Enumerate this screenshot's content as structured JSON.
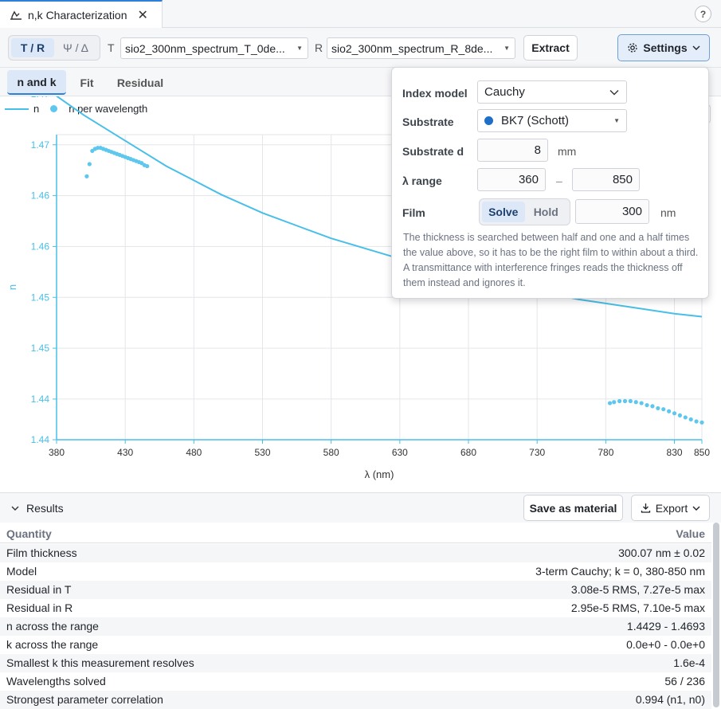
{
  "tab": {
    "title": "n,k Characterization",
    "close": "✕"
  },
  "help": "?",
  "toolbar": {
    "mode_tr": "T / R",
    "mode_psi": "Ψ / Δ",
    "t_label": "T",
    "t_file": "sio2_300nm_spectrum_T_0de...",
    "r_label": "R",
    "r_file": "sio2_300nm_spectrum_R_8de...",
    "extract": "Extract",
    "settings": "Settings"
  },
  "view_tabs": [
    "n and k",
    "Fit",
    "Residual"
  ],
  "settings": {
    "index_model_label": "Index model",
    "index_model": "Cauchy",
    "substrate_label": "Substrate",
    "substrate": "BK7 (Schott)",
    "substrate_color": "#1f6fc9",
    "substrate_d_label": "Substrate d",
    "substrate_d": "8",
    "substrate_d_unit": "mm",
    "range_label": "λ range",
    "range_min": "360",
    "range_sep": "–",
    "range_max": "850",
    "film_label": "Film",
    "film_solve": "Solve",
    "film_hold": "Hold",
    "film_value": "300",
    "film_unit": "nm",
    "note": "The thickness is searched between half and one and a half times the value above, so it has to be the right film to within about a third. A transmittance with interference fringes reads the thickness off them instead and ignores it."
  },
  "chart_data": {
    "type": "line",
    "xlabel": "λ (nm)",
    "ylabel": "n",
    "xlim": [
      380,
      850
    ],
    "ylim": [
      1.44,
      1.47
    ],
    "xticks": [
      380,
      430,
      480,
      530,
      580,
      630,
      680,
      730,
      780,
      830,
      850
    ],
    "yticks": [
      1.44,
      1.444,
      1.449,
      1.454,
      1.459,
      1.464,
      1.469,
      1.474
    ],
    "ytick_labels": [
      "1.44",
      "1.44",
      "1.45",
      "1.45",
      "1.46",
      "1.46",
      "1.47",
      "1.47"
    ],
    "grid": true,
    "legend": [
      {
        "label": "n",
        "kind": "line"
      },
      {
        "label": "n per wavelength",
        "kind": "dots"
      }
    ],
    "series_color": "#48bfe8",
    "curve": {
      "x": [
        380,
        400,
        430,
        460,
        480,
        500,
        530,
        560,
        580,
        600,
        630,
        660,
        680,
        700,
        730,
        760,
        780,
        800,
        830,
        850
      ],
      "y": [
        1.4738,
        1.4719,
        1.4694,
        1.4669,
        1.4655,
        1.4641,
        1.4623,
        1.4608,
        1.4598,
        1.459,
        1.4578,
        1.4567,
        1.456,
        1.4554,
        1.4546,
        1.4538,
        1.4534,
        1.453,
        1.4524,
        1.4521
      ]
    },
    "points": [
      {
        "x": 402,
        "y": 1.4659
      },
      {
        "x": 404,
        "y": 1.4671
      },
      {
        "x": 406,
        "y": 1.4684
      },
      {
        "x": 408,
        "y": 1.4686
      },
      {
        "x": 410,
        "y": 1.4687
      },
      {
        "x": 412,
        "y": 1.4687
      },
      {
        "x": 414,
        "y": 1.4686
      },
      {
        "x": 416,
        "y": 1.4685
      },
      {
        "x": 418,
        "y": 1.4684
      },
      {
        "x": 420,
        "y": 1.4683
      },
      {
        "x": 422,
        "y": 1.4682
      },
      {
        "x": 424,
        "y": 1.4681
      },
      {
        "x": 426,
        "y": 1.468
      },
      {
        "x": 428,
        "y": 1.4679
      },
      {
        "x": 430,
        "y": 1.4678
      },
      {
        "x": 432,
        "y": 1.4677
      },
      {
        "x": 434,
        "y": 1.4676
      },
      {
        "x": 436,
        "y": 1.4675
      },
      {
        "x": 438,
        "y": 1.4674
      },
      {
        "x": 440,
        "y": 1.4673
      },
      {
        "x": 442,
        "y": 1.4672
      },
      {
        "x": 444,
        "y": 1.467
      },
      {
        "x": 446,
        "y": 1.4669
      },
      {
        "x": 783,
        "y": 1.4436
      },
      {
        "x": 786,
        "y": 1.4437
      },
      {
        "x": 790,
        "y": 1.4438
      },
      {
        "x": 794,
        "y": 1.4438
      },
      {
        "x": 798,
        "y": 1.4438
      },
      {
        "x": 802,
        "y": 1.4437
      },
      {
        "x": 806,
        "y": 1.4436
      },
      {
        "x": 810,
        "y": 1.4434
      },
      {
        "x": 814,
        "y": 1.4433
      },
      {
        "x": 818,
        "y": 1.4431
      },
      {
        "x": 822,
        "y": 1.443
      },
      {
        "x": 826,
        "y": 1.4428
      },
      {
        "x": 830,
        "y": 1.4426
      },
      {
        "x": 834,
        "y": 1.4424
      },
      {
        "x": 838,
        "y": 1.4422
      },
      {
        "x": 842,
        "y": 1.442
      },
      {
        "x": 846,
        "y": 1.4418
      },
      {
        "x": 850,
        "y": 1.4417
      }
    ]
  },
  "results": {
    "title": "Results",
    "save": "Save as material",
    "export": "Export",
    "col_quantity": "Quantity",
    "col_value": "Value",
    "rows": [
      {
        "q": "Film thickness",
        "v": "300.07 nm ± 0.02"
      },
      {
        "q": "Model",
        "v": "3-term Cauchy; k = 0, 380-850 nm"
      },
      {
        "q": "Residual in T",
        "v": "3.08e-5 RMS, 7.27e-5 max"
      },
      {
        "q": "Residual in R",
        "v": "2.95e-5 RMS, 7.10e-5 max"
      },
      {
        "q": "n across the range",
        "v": "1.4429 - 1.4693"
      },
      {
        "q": "k across the range",
        "v": "0.0e+0 - 0.0e+0"
      },
      {
        "q": "Smallest k this measurement resolves",
        "v": "1.6e-4"
      },
      {
        "q": "Wavelengths solved",
        "v": "56 / 236"
      },
      {
        "q": "Strongest parameter correlation",
        "v": "0.994 (n1, n0)"
      }
    ]
  }
}
